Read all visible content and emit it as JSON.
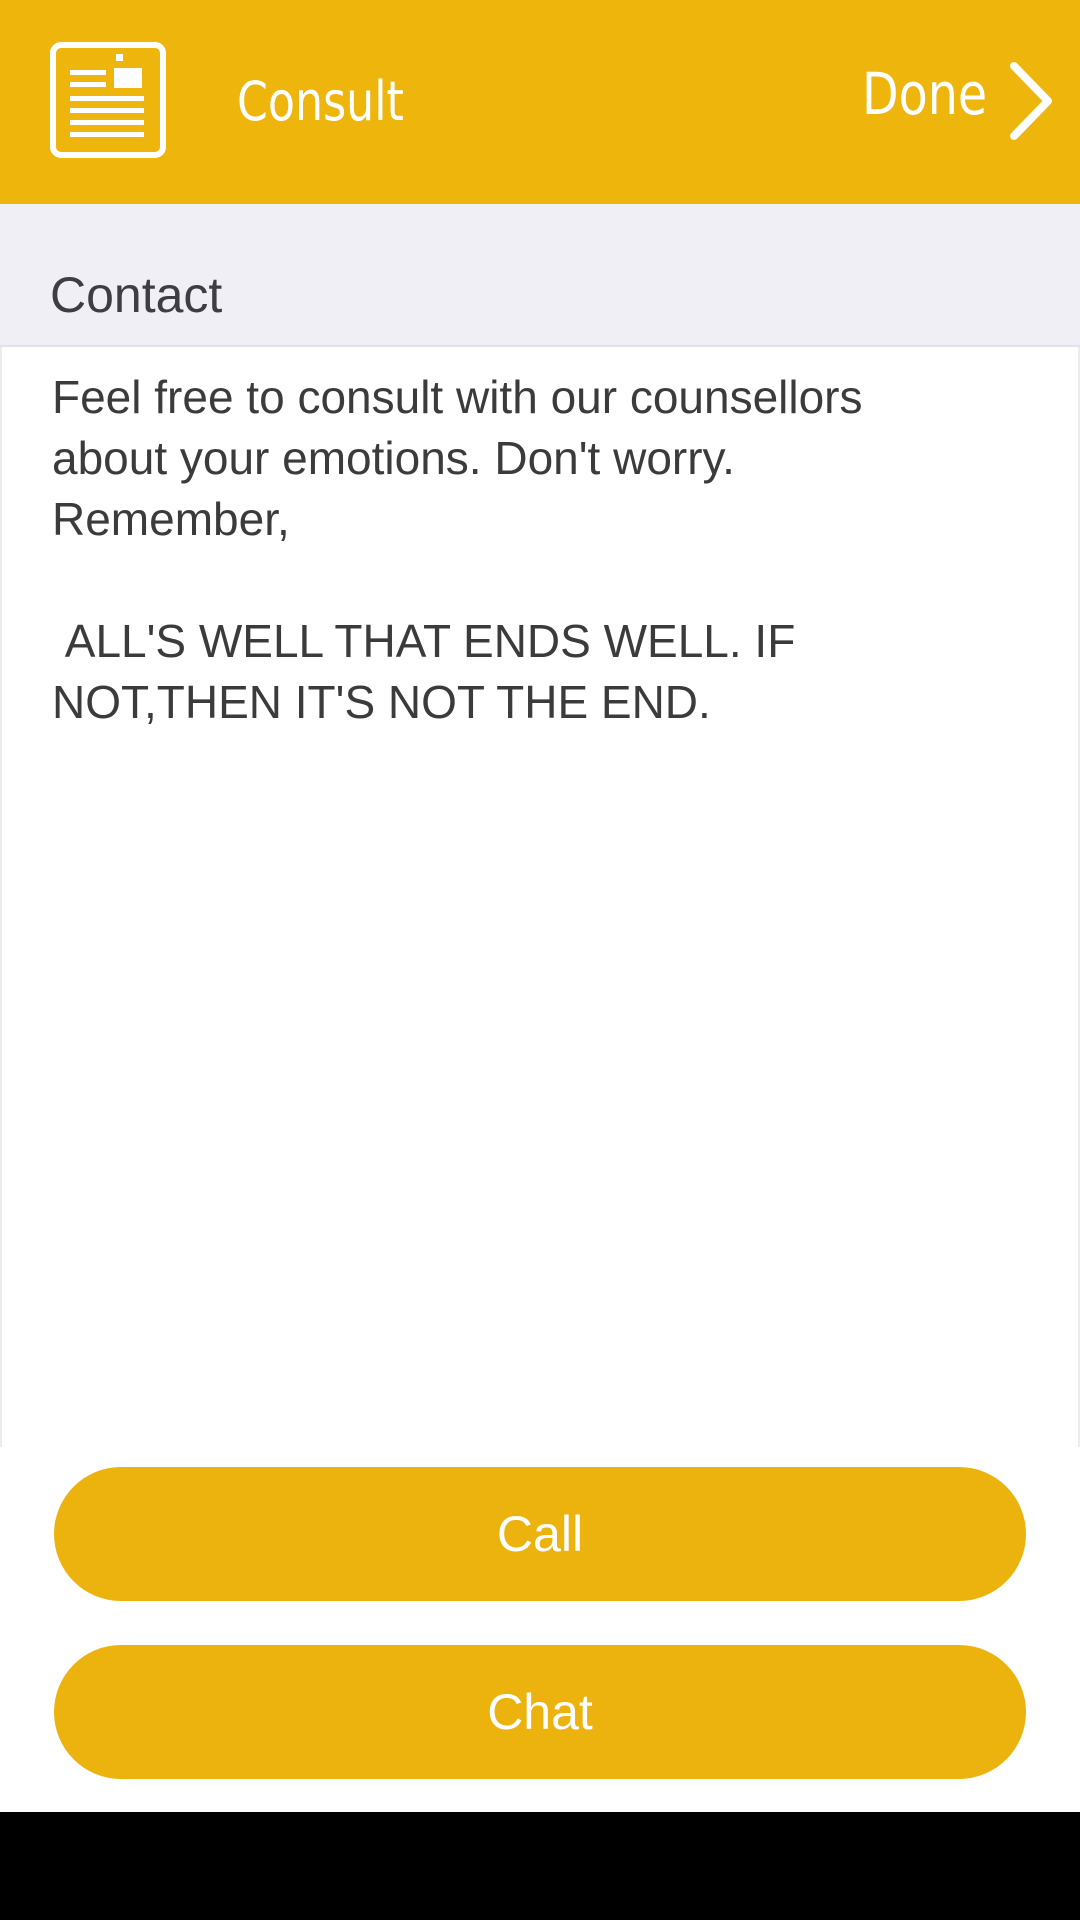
{
  "header": {
    "title": "Consult",
    "done_label": "Done",
    "icon": "document-icon",
    "chevron_icon": "chevron-right-icon",
    "background_color": "#eeb50d"
  },
  "section": {
    "title": "Contact"
  },
  "content": {
    "text": "Feel free to consult with our counsellors\nabout your emotions. Don't worry.\nRemember,\n\n ALL'S WELL THAT ENDS WELL. IF\nNOT,THEN IT'S NOT THE END."
  },
  "actions": {
    "call_label": "Call",
    "chat_label": "Chat",
    "button_color": "#ecb30e"
  }
}
